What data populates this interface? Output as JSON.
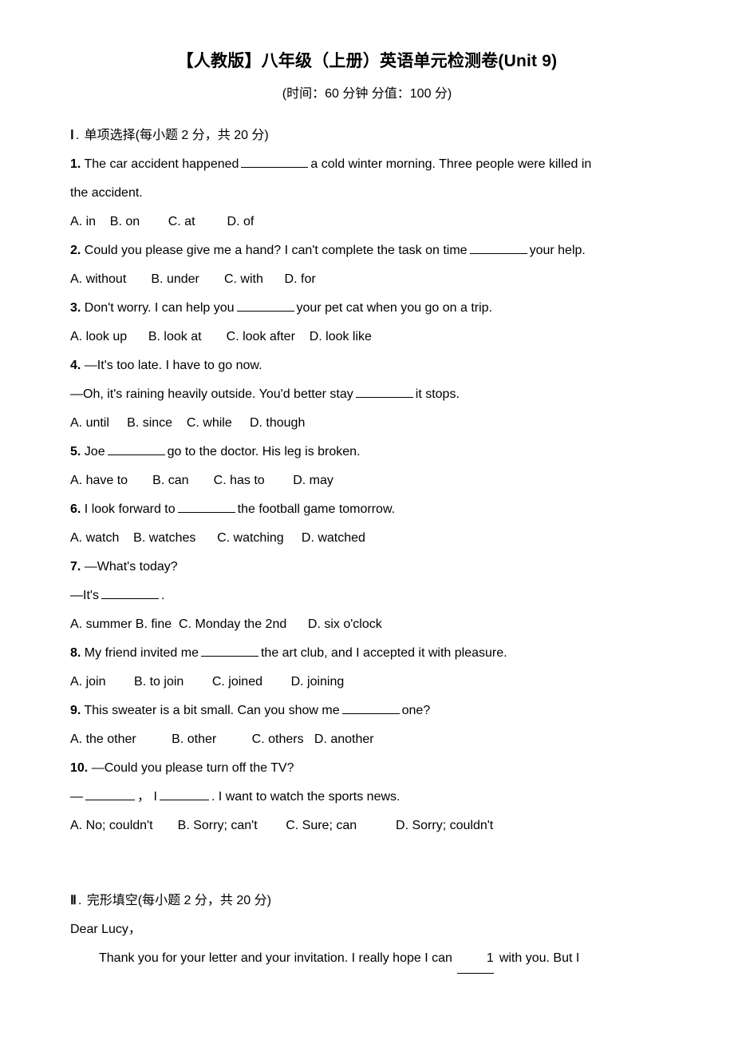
{
  "document": {
    "title": "【人教版】八年级（上册）英语单元检测卷(Unit 9)",
    "subtitle": "(时间：60 分钟   分值：100 分)"
  },
  "sections": [
    {
      "numeral": "Ⅰ",
      "separator": ".",
      "heading": "单项选择(每小题 2 分，共 20 分)"
    },
    {
      "numeral": "Ⅱ",
      "separator": ".",
      "heading": "完形填空(每小题 2 分，共 20 分)"
    }
  ],
  "questions": [
    {
      "num": "1.",
      "stem_before": "The car accident happened",
      "stem_after": "a cold winter morning. Three people were killed in",
      "stem_wrap": "the accident.",
      "options": "A. in    B. on        C. at         D. of"
    },
    {
      "num": "2.",
      "stem_before": "Could you please give me a hand? I can't complete the task on time",
      "stem_after": "your help.",
      "options": "A. without       B. under       C. with      D. for"
    },
    {
      "num": "3.",
      "stem_before": "Don't worry. I can help you",
      "stem_after": "your pet cat when you go on a trip.",
      "options": "A. look up      B. look at       C. look after    D. look like"
    },
    {
      "num": "4.",
      "line1": "—It's too late. I have to go now.",
      "line2_before": "—Oh, it's raining heavily outside. You'd better stay",
      "line2_after": "it stops.",
      "options": "A. until     B. since    C. while     D. though"
    },
    {
      "num": "5.",
      "stem_before": "Joe",
      "stem_after": "go to the doctor. His leg is broken.",
      "options": "A. have to       B. can       C. has to        D. may"
    },
    {
      "num": "6.",
      "stem_before": "I look forward to",
      "stem_after": "the football game tomorrow.",
      "options": "A. watch    B. watches      C. watching     D. watched"
    },
    {
      "num": "7.",
      "line1": "—What's today?",
      "line2_before": "—It's",
      "line2_after": ".",
      "options": "A. summer B. fine  C. Monday the 2nd      D. six o'clock"
    },
    {
      "num": "8.",
      "stem_before": "My friend invited me",
      "stem_after": "the art club, and I accepted it with pleasure.",
      "options": "A. join        B. to join        C. joined        D. joining"
    },
    {
      "num": "9.",
      "stem_before": "This sweater is a bit small. Can you show me",
      "stem_after": "one?",
      "options": "A. the other          B. other          C. others   D. another"
    },
    {
      "num": "10.",
      "line1": "—Could you please turn off the TV?",
      "line2_prefix": "—",
      "line2_mid": "，  I",
      "line2_after": ". I want to watch the sports news.",
      "options": "A. No; couldn't       B. Sorry; can't        C. Sure; can           D. Sorry; couldn't"
    }
  ],
  "cloze": {
    "salutation": "Dear Lucy，",
    "para_before": "Thank you for your letter and your invitation. I really hope I can",
    "blank_number": "1",
    "para_after": "with you. But I"
  }
}
